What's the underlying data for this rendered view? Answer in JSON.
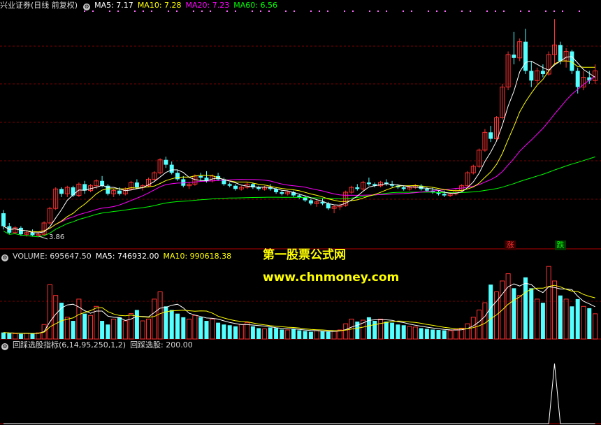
{
  "header_main": {
    "stock": "兴业证券(日线 前复权)",
    "ma5": "MA5: 7.17",
    "ma10": "MA10: 7.28",
    "ma20": "MA20: 7.23",
    "ma60": "MA60: 6.56"
  },
  "header_volume": {
    "volume": "VOLUME: 695647.50",
    "ma5": "MA5: 746932.00",
    "ma10": "MA10: 990618.38"
  },
  "header_indicator": {
    "name": "回踩选股指标(6,14,95,250,1,2)",
    "value": "回踩选股: 200.00"
  },
  "annotations": {
    "low_price": "3.86",
    "rise_tag": "涨",
    "fall_tag": "跌"
  },
  "watermark": {
    "line1": "第一股票公式网",
    "line2": "www.chnmoney.com"
  },
  "colors": {
    "up": "#ff3232",
    "down": "#54ffff",
    "ma5": "#ffffff",
    "ma10": "#ffff00",
    "ma20": "#ff00ff",
    "ma60": "#00ff00",
    "grid": "#7a0000",
    "indicator": "#ffffff"
  },
  "chart_data": {
    "type": "candlestick+volume+indicator",
    "price_ylim": [
      3.5,
      10.8
    ],
    "candles": [
      [
        4.6,
        4.7,
        4.1,
        4.2
      ],
      [
        4.2,
        4.3,
        3.95,
        4.0
      ],
      [
        4.0,
        4.2,
        3.95,
        4.15
      ],
      [
        4.15,
        4.2,
        3.9,
        3.95
      ],
      [
        3.95,
        4.05,
        3.88,
        4.0
      ],
      [
        4.0,
        4.1,
        3.9,
        3.92
      ],
      [
        3.92,
        4.0,
        3.86,
        3.95
      ],
      [
        3.95,
        4.35,
        3.9,
        4.3
      ],
      [
        4.3,
        4.8,
        4.25,
        4.75
      ],
      [
        4.75,
        5.4,
        4.7,
        5.35
      ],
      [
        5.35,
        5.4,
        5.1,
        5.2
      ],
      [
        5.2,
        5.45,
        5.1,
        5.4
      ],
      [
        5.4,
        5.45,
        5.1,
        5.15
      ],
      [
        5.15,
        5.55,
        5.1,
        5.5
      ],
      [
        5.5,
        5.6,
        5.2,
        5.3
      ],
      [
        5.3,
        5.5,
        5.25,
        5.45
      ],
      [
        5.45,
        5.65,
        5.35,
        5.6
      ],
      [
        5.6,
        5.75,
        5.4,
        5.45
      ],
      [
        5.45,
        5.5,
        5.15,
        5.2
      ],
      [
        5.2,
        5.35,
        5.1,
        5.3
      ],
      [
        5.3,
        5.4,
        5.15,
        5.2
      ],
      [
        5.2,
        5.4,
        5.15,
        5.35
      ],
      [
        5.35,
        5.6,
        5.3,
        5.55
      ],
      [
        5.55,
        5.65,
        5.35,
        5.4
      ],
      [
        5.4,
        5.5,
        5.3,
        5.45
      ],
      [
        5.45,
        5.7,
        5.4,
        5.65
      ],
      [
        5.65,
        5.9,
        5.6,
        5.85
      ],
      [
        5.85,
        6.3,
        5.8,
        6.25
      ],
      [
        6.25,
        6.35,
        6.0,
        6.1
      ],
      [
        6.1,
        6.2,
        5.8,
        5.85
      ],
      [
        5.85,
        5.95,
        5.6,
        5.65
      ],
      [
        5.65,
        5.75,
        5.4,
        5.45
      ],
      [
        5.45,
        5.55,
        5.35,
        5.5
      ],
      [
        5.5,
        5.8,
        5.45,
        5.75
      ],
      [
        5.75,
        5.85,
        5.6,
        5.7
      ],
      [
        5.7,
        5.9,
        5.55,
        5.6
      ],
      [
        5.6,
        5.8,
        5.55,
        5.75
      ],
      [
        5.75,
        5.85,
        5.6,
        5.65
      ],
      [
        5.65,
        5.7,
        5.45,
        5.5
      ],
      [
        5.5,
        5.55,
        5.4,
        5.45
      ],
      [
        5.45,
        5.5,
        5.3,
        5.35
      ],
      [
        5.35,
        5.45,
        5.3,
        5.4
      ],
      [
        5.4,
        5.55,
        5.35,
        5.5
      ],
      [
        5.5,
        5.55,
        5.35,
        5.4
      ],
      [
        5.4,
        5.45,
        5.3,
        5.35
      ],
      [
        5.35,
        5.45,
        5.3,
        5.4
      ],
      [
        5.4,
        5.5,
        5.3,
        5.35
      ],
      [
        5.35,
        5.4,
        5.2,
        5.25
      ],
      [
        5.25,
        5.3,
        5.15,
        5.2
      ],
      [
        5.2,
        5.3,
        5.15,
        5.25
      ],
      [
        5.25,
        5.3,
        5.1,
        5.15
      ],
      [
        5.15,
        5.2,
        5.05,
        5.1
      ],
      [
        5.1,
        5.15,
        4.95,
        5.0
      ],
      [
        5.0,
        5.05,
        4.85,
        4.9
      ],
      [
        4.9,
        5.0,
        4.8,
        4.95
      ],
      [
        4.95,
        5.05,
        4.85,
        4.9
      ],
      [
        4.9,
        4.95,
        4.7,
        4.75
      ],
      [
        4.75,
        4.85,
        4.6,
        4.8
      ],
      [
        4.8,
        4.9,
        4.7,
        4.85
      ],
      [
        4.85,
        5.3,
        4.8,
        5.25
      ],
      [
        5.25,
        5.45,
        5.2,
        5.4
      ],
      [
        5.4,
        5.5,
        5.3,
        5.35
      ],
      [
        5.35,
        5.6,
        5.3,
        5.55
      ],
      [
        5.55,
        5.7,
        5.45,
        5.5
      ],
      [
        5.5,
        5.55,
        5.4,
        5.45
      ],
      [
        5.45,
        5.6,
        5.4,
        5.55
      ],
      [
        5.55,
        5.65,
        5.45,
        5.5
      ],
      [
        5.5,
        5.6,
        5.4,
        5.45
      ],
      [
        5.45,
        5.5,
        5.35,
        5.4
      ],
      [
        5.4,
        5.45,
        5.3,
        5.35
      ],
      [
        5.35,
        5.45,
        5.3,
        5.4
      ],
      [
        5.4,
        5.5,
        5.35,
        5.45
      ],
      [
        5.45,
        5.5,
        5.3,
        5.35
      ],
      [
        5.35,
        5.4,
        5.25,
        5.3
      ],
      [
        5.3,
        5.4,
        5.2,
        5.25
      ],
      [
        5.25,
        5.3,
        5.15,
        5.2
      ],
      [
        5.2,
        5.3,
        5.1,
        5.15
      ],
      [
        5.15,
        5.25,
        5.1,
        5.2
      ],
      [
        5.2,
        5.35,
        5.15,
        5.3
      ],
      [
        5.3,
        5.5,
        5.25,
        5.45
      ],
      [
        5.45,
        5.9,
        5.4,
        5.85
      ],
      [
        5.85,
        6.1,
        5.8,
        6.05
      ],
      [
        6.05,
        6.6,
        6.0,
        6.55
      ],
      [
        6.55,
        7.2,
        6.5,
        7.1
      ],
      [
        7.1,
        7.3,
        6.8,
        6.9
      ],
      [
        6.9,
        7.6,
        6.85,
        7.55
      ],
      [
        7.55,
        8.6,
        7.5,
        8.5
      ],
      [
        8.5,
        9.6,
        8.4,
        9.5
      ],
      [
        9.5,
        10.2,
        9.2,
        9.4
      ],
      [
        9.4,
        10.0,
        9.3,
        9.9
      ],
      [
        9.9,
        10.3,
        8.9,
        9.0
      ],
      [
        9.0,
        9.3,
        8.5,
        8.7
      ],
      [
        8.7,
        9.1,
        8.6,
        9.0
      ],
      [
        9.0,
        9.2,
        8.8,
        8.9
      ],
      [
        8.9,
        9.6,
        8.85,
        9.5
      ],
      [
        9.5,
        10.6,
        9.2,
        9.8
      ],
      [
        9.8,
        9.9,
        9.2,
        9.3
      ],
      [
        9.3,
        9.7,
        9.1,
        9.6
      ],
      [
        9.6,
        9.65,
        8.9,
        9.0
      ],
      [
        9.0,
        9.1,
        8.3,
        8.5
      ],
      [
        8.5,
        9.0,
        8.4,
        8.8
      ],
      [
        8.8,
        9.0,
        8.6,
        8.7
      ],
      [
        8.7,
        9.2,
        8.6,
        9.0
      ]
    ],
    "volume_ylim": [
      0,
      2100000
    ],
    "volume": [
      180000,
      160000,
      150000,
      140000,
      160000,
      150000,
      170000,
      400000,
      1500000,
      1200000,
      1000000,
      600000,
      500000,
      1100000,
      700000,
      650000,
      900000,
      500000,
      400000,
      550000,
      600000,
      500000,
      700000,
      800000,
      500000,
      550000,
      1100000,
      1300000,
      900000,
      800000,
      700000,
      600000,
      550000,
      650000,
      600000,
      500000,
      550000,
      450000,
      400000,
      380000,
      350000,
      400000,
      450000,
      350000,
      300000,
      280000,
      320000,
      300000,
      260000,
      250000,
      270000,
      240000,
      220000,
      200000,
      230000,
      210000,
      200000,
      220000,
      250000,
      420000,
      550000,
      480000,
      520000,
      600000,
      500000,
      550000,
      480000,
      450000,
      400000,
      380000,
      350000,
      330000,
      300000,
      280000,
      260000,
      250000,
      240000,
      230000,
      260000,
      300000,
      420000,
      600000,
      800000,
      1000000,
      1500000,
      1300000,
      1600000,
      1800000,
      1400000,
      1200000,
      1700000,
      1400000,
      1100000,
      1000000,
      2000000,
      1600000,
      1200000,
      1100000,
      900000,
      1100000,
      900000,
      850000,
      695647
    ],
    "indicator_ylim": [
      0,
      240
    ],
    "indicator": {
      "signal_index": 95,
      "signal_value": 200
    }
  }
}
